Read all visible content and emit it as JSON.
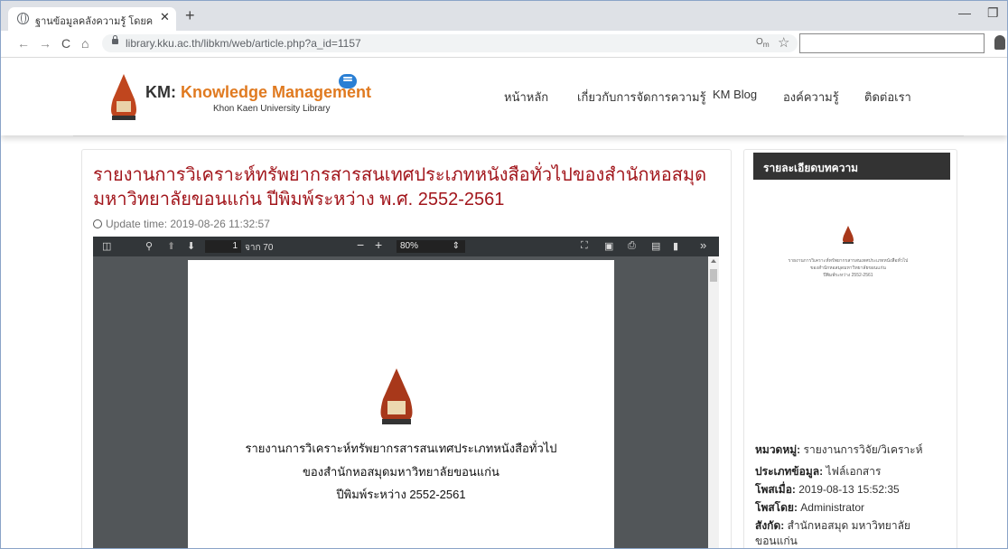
{
  "browser": {
    "tab_title": "ฐานข้อมูลคลังความรู้ โดยคณะกรรมการ",
    "url": "library.kku.ac.th/libkm/web/article.php?a_id=1157"
  },
  "site": {
    "brand_km": "KM:",
    "brand_name": "Knowledge Management",
    "brand_sub": "Khon Kaen University Library",
    "menu": [
      "หน้าหลัก",
      "เกี่ยวกับการจัดการความรู้",
      "KM Blog",
      "องค์ความรู้",
      "ติดต่อเรา"
    ]
  },
  "article": {
    "title": "รายงานการวิเคราะห์ทรัพยากรสารสนเทศประเภทหนังสือทั่วไปของสำนักหอสมุดมหาวิทยาลัยขอนแก่น ปีพิมพ์ระหว่าง พ.ศ. 2552-2561",
    "update_time": "Update time: 2019-08-26 11:32:57"
  },
  "pdf": {
    "page_current": "1",
    "page_total": "จาก 70",
    "zoom": "80%",
    "zoom_arrow": "⇕",
    "doc_lines": [
      "รายงานการวิเคราะห์ทรัพยากรสารสนเทศประเภทหนังสือทั่วไป",
      "ของสำนักหอสมุดมหาวิทยาลัยขอนแก่น",
      "ปีพิมพ์ระหว่าง 2552-2561"
    ]
  },
  "sidebar": {
    "heading": "รายละเอียดบทความ",
    "category_label": "หมวดหมู่:",
    "category": "รายงานการวิจัย/วิเคราะห์",
    "type_label": "ประเภทข้อมูล:",
    "type": "ไฟล์เอกสาร",
    "posted_label": "โพสเมื่อ:",
    "posted": "2019-08-13 15:52:35",
    "by_label": "โพสโดย:",
    "by": "Administrator",
    "affiliation_label": "สังกัด:",
    "affiliation_line1": "สำนักหอสมุด มหาวิทยาลัย",
    "affiliation_line2": "ขอนแก่น"
  },
  "colors": {
    "title": "#a2161c",
    "accent": "#e07a20",
    "chat": "#2a7fd4"
  }
}
